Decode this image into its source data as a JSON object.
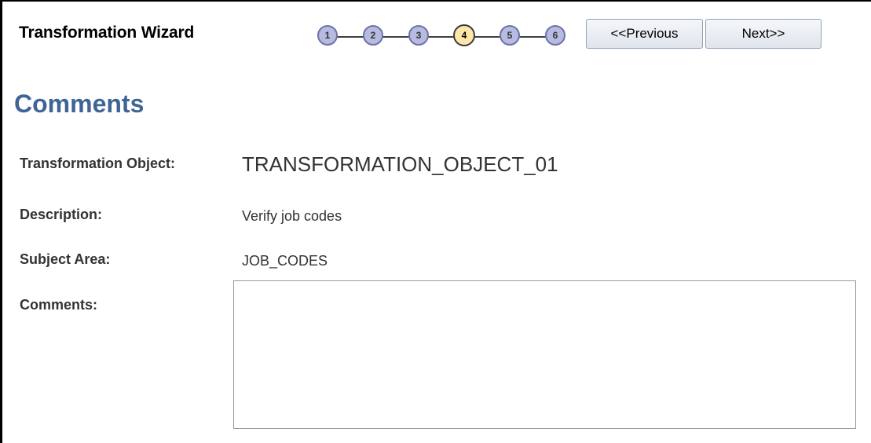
{
  "wizard": {
    "title": "Transformation Wizard",
    "steps": [
      "1",
      "2",
      "3",
      "4",
      "5",
      "6"
    ],
    "current_step": 4,
    "previous_label": "<<Previous",
    "next_label": "Next>>"
  },
  "page": {
    "title": "Comments"
  },
  "fields": {
    "transformation_object_label": "Transformation Object:",
    "transformation_object_value": "TRANSFORMATION_OBJECT_01",
    "description_label": "Description:",
    "description_value": "Verify job codes",
    "subject_area_label": "Subject Area:",
    "subject_area_value": "JOB_CODES",
    "comments_label": "Comments:",
    "comments_value": ""
  },
  "colors": {
    "page_title": "#3e6596",
    "step_inactive": "#b6bbdf",
    "step_active": "#fde7a9"
  }
}
